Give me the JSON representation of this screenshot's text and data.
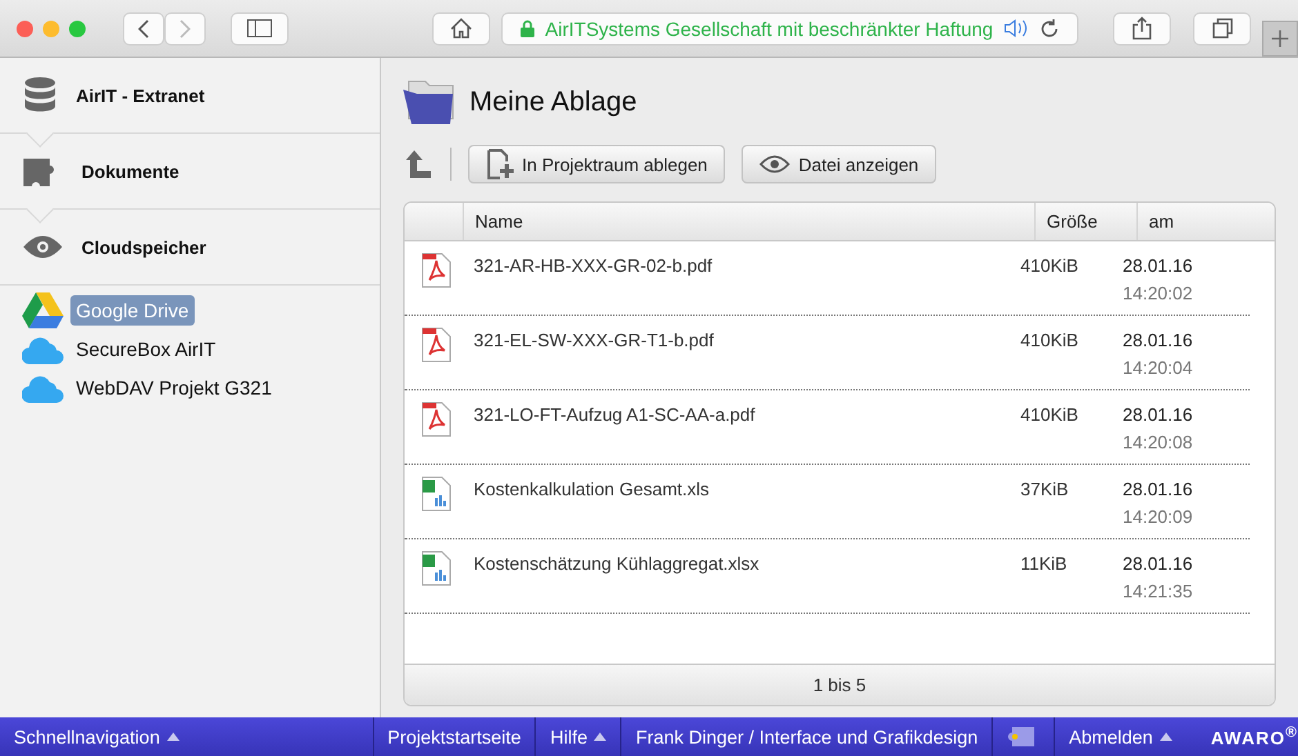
{
  "browser": {
    "address": "AirITSystems Gesellschaft mit beschränkter Haftung"
  },
  "sidebar": {
    "sections": [
      {
        "kind": "database",
        "label": "AirIT - Extranet"
      },
      {
        "kind": "puzzle",
        "label": "Dokumente"
      },
      {
        "kind": "eye",
        "label": "Cloudspeicher"
      }
    ],
    "storages": [
      {
        "kind": "drive",
        "label": "Google Drive",
        "selected": true
      },
      {
        "kind": "cloud",
        "label": "SecureBox AirIT",
        "selected": false
      },
      {
        "kind": "cloud",
        "label": "WebDAV Projekt G321",
        "selected": false
      }
    ]
  },
  "content": {
    "title": "Meine Ablage",
    "actions": [
      {
        "kind": "add",
        "label": "In Projektraum ablegen"
      },
      {
        "kind": "view",
        "label": "Datei anzeigen"
      }
    ],
    "table": {
      "columns": [
        "Name",
        "Größe",
        "am"
      ],
      "rows": [
        {
          "kind": "pdf",
          "name": "321-AR-HB-XXX-GR-02-b.pdf",
          "size": "410KiB",
          "date": "28.01.16",
          "time": "14:20:02"
        },
        {
          "kind": "pdf",
          "name": "321-EL-SW-XXX-GR-T1-b.pdf",
          "size": "410KiB",
          "date": "28.01.16",
          "time": "14:20:04"
        },
        {
          "kind": "pdf",
          "name": "321-LO-FT-Aufzug A1-SC-AA-a.pdf",
          "size": "410KiB",
          "date": "28.01.16",
          "time": "14:20:08"
        },
        {
          "kind": "xls",
          "name": "Kostenkalkulation Gesamt.xls",
          "size": "37KiB",
          "date": "28.01.16",
          "time": "14:20:09"
        },
        {
          "kind": "xls",
          "name": "Kostenschätzung Kühlaggregat.xlsx",
          "size": "11KiB",
          "date": "28.01.16",
          "time": "14:21:35"
        }
      ],
      "footer": "1 bis 5"
    }
  },
  "bottom_bar": {
    "items": [
      {
        "label": "Schnellnavigation",
        "menu": true
      },
      {
        "label": "Projektstartseite",
        "menu": false
      },
      {
        "label": "Hilfe",
        "menu": true
      },
      {
        "label": "Frank Dinger / Interface und Grafikdesign",
        "menu": false
      }
    ],
    "logout": {
      "label": "Abmelden",
      "menu": true
    },
    "logo": "AWARO$^{®}$"
  }
}
